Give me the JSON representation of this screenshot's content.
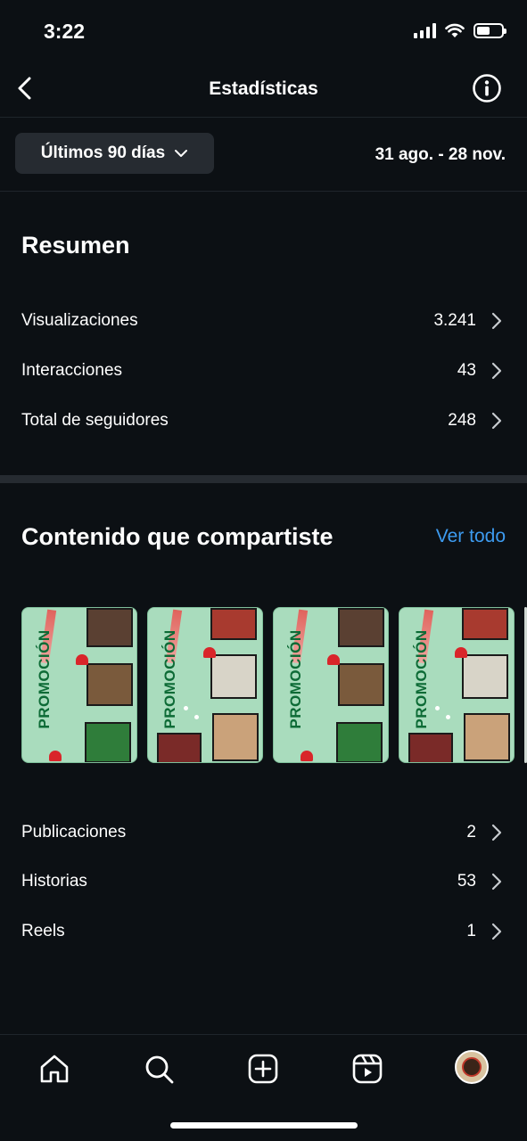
{
  "status_bar": {
    "time": "3:22"
  },
  "header": {
    "title": "Estadísticas"
  },
  "filter": {
    "range_label": "Últimos 90 días",
    "date_range": "31 ago. - 28 nov."
  },
  "summary": {
    "title": "Resumen",
    "rows": [
      {
        "label": "Visualizaciones",
        "value": "3.241"
      },
      {
        "label": "Interacciones",
        "value": "43"
      },
      {
        "label": "Total de seguidores",
        "value": "248"
      }
    ]
  },
  "content": {
    "title": "Contenido que compartiste",
    "see_all": "Ver todo",
    "thumbnails": [
      {
        "text": "PROMOCIÓN"
      },
      {
        "text": "PROMOCIÓN"
      },
      {
        "text": "PROMOCIÓN"
      },
      {
        "text": "PROMOCIÓN"
      }
    ],
    "rows": [
      {
        "label": "Publicaciones",
        "value": "2"
      },
      {
        "label": "Historias",
        "value": "53"
      },
      {
        "label": "Reels",
        "value": "1"
      }
    ]
  },
  "tab_bar": {
    "items": [
      {
        "icon": "home-icon"
      },
      {
        "icon": "search-icon"
      },
      {
        "icon": "create-icon"
      },
      {
        "icon": "reels-icon"
      },
      {
        "icon": "profile-avatar"
      }
    ]
  },
  "colors": {
    "background": "#0c1014",
    "accent": "#3d9bf0",
    "surface": "#262b31"
  }
}
